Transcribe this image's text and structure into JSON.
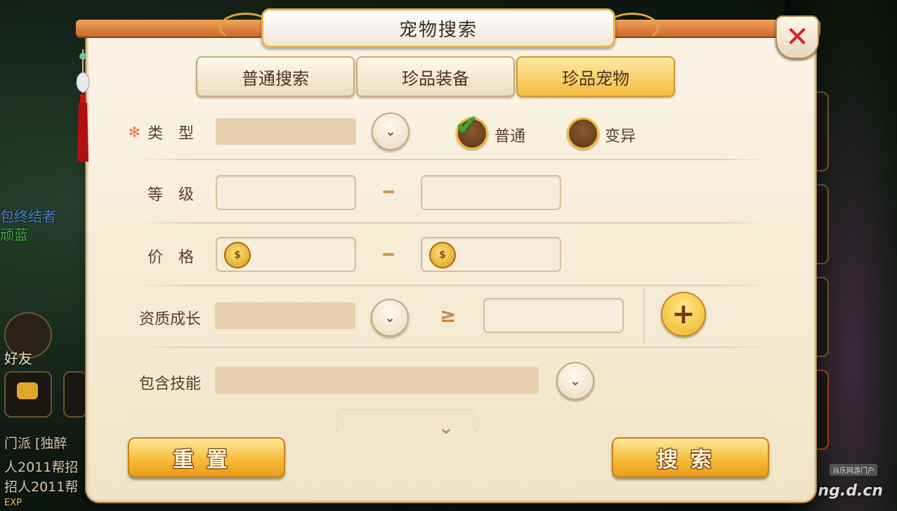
{
  "dialog": {
    "title": "宠物搜索"
  },
  "tabs": [
    {
      "label": "普通搜索",
      "active": false
    },
    {
      "label": "珍品装备",
      "active": false
    },
    {
      "label": "珍品宠物",
      "active": true
    }
  ],
  "form": {
    "type": {
      "label": "类　型",
      "value": "",
      "options": [
        {
          "label": "普通",
          "checked": true
        },
        {
          "label": "变异",
          "checked": false
        }
      ]
    },
    "level": {
      "label": "等　级",
      "min": "",
      "max": "",
      "separator": "-"
    },
    "price": {
      "label": "价　格",
      "min": "",
      "max": "",
      "separator": "-"
    },
    "growth": {
      "label": "资质成长",
      "value": "",
      "operator": "≥",
      "threshold": ""
    },
    "skills": {
      "label": "包含技能",
      "value": ""
    }
  },
  "buttons": {
    "reset": "重置",
    "search": "搜索"
  },
  "background": {
    "left_text_1": "包终结者",
    "left_text_2": "顽蓝",
    "friends_label": "好友",
    "chat_lines": [
      "门派 [独醉",
      "人2011帮招",
      "招人2011帮"
    ],
    "exp_label": "EXP"
  },
  "watermark": {
    "site": "ng.d.cn",
    "tag": "当乐网游门户"
  },
  "colors": {
    "accent": "#f3bd3f",
    "close": "#d62020",
    "check": "#39a82a"
  },
  "icons": {
    "close": "close-icon",
    "dropdown": "chevron-down-icon",
    "add": "plus-icon",
    "coin": "coin-icon"
  }
}
